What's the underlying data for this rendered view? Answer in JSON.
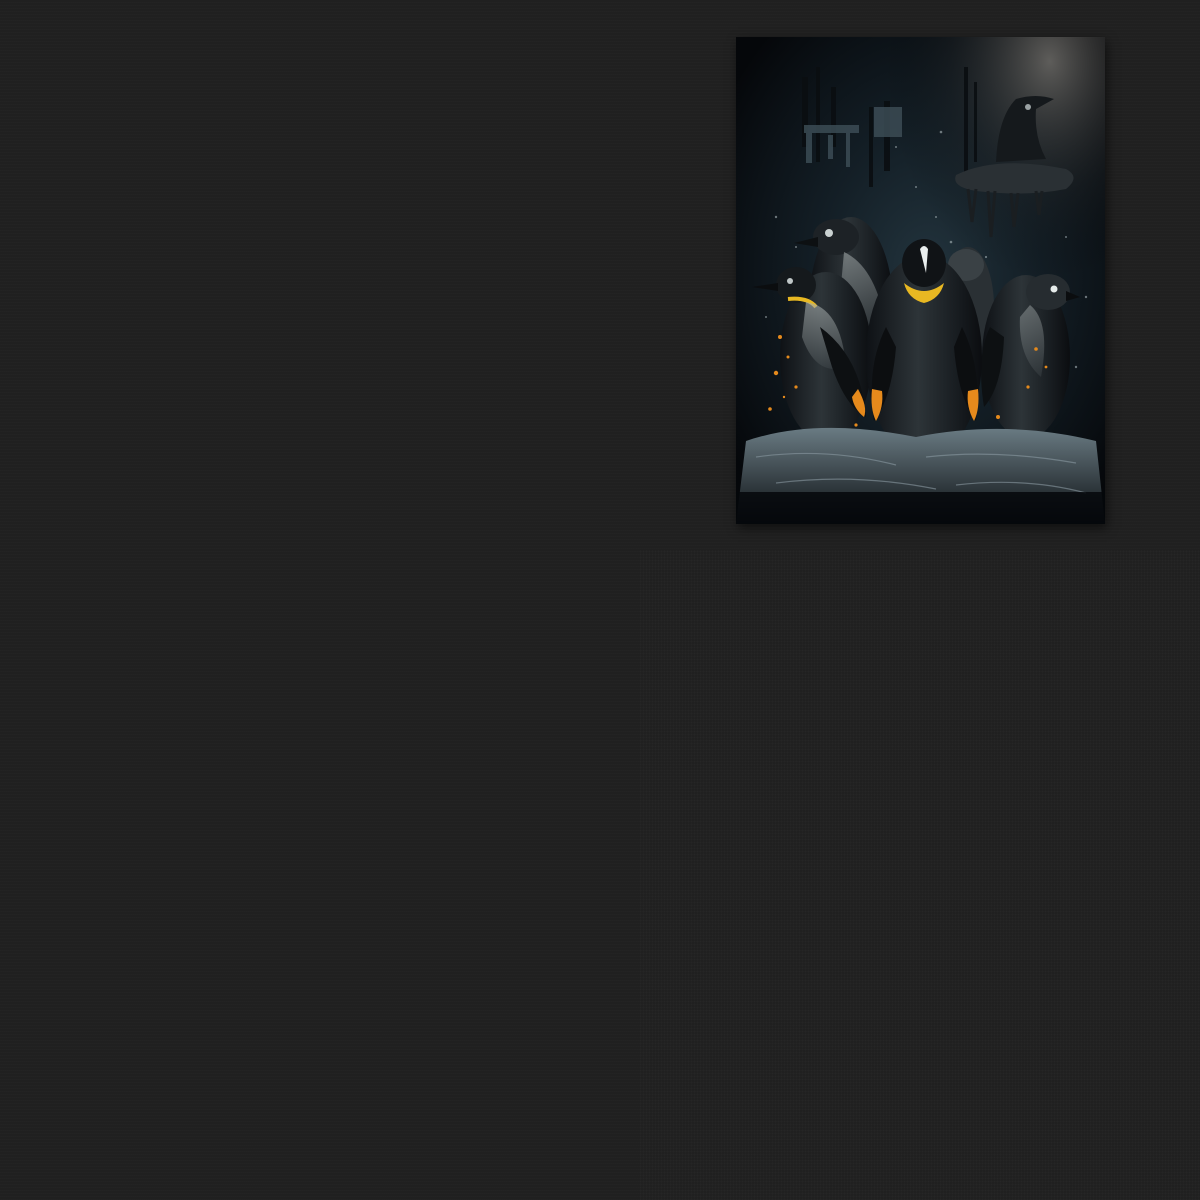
{
  "canvas": {
    "background_color": "#202020"
  },
  "artwork": {
    "subject": "penguins-icon",
    "colors": {
      "background": "#05070a",
      "teal_haze": "#1b2a33",
      "penguin_body": "#15191d",
      "penguin_shade": "#8d9698",
      "orange_accent": "#e68a1c",
      "yellow_neck": "#e8b822",
      "ice": "#566670"
    }
  }
}
